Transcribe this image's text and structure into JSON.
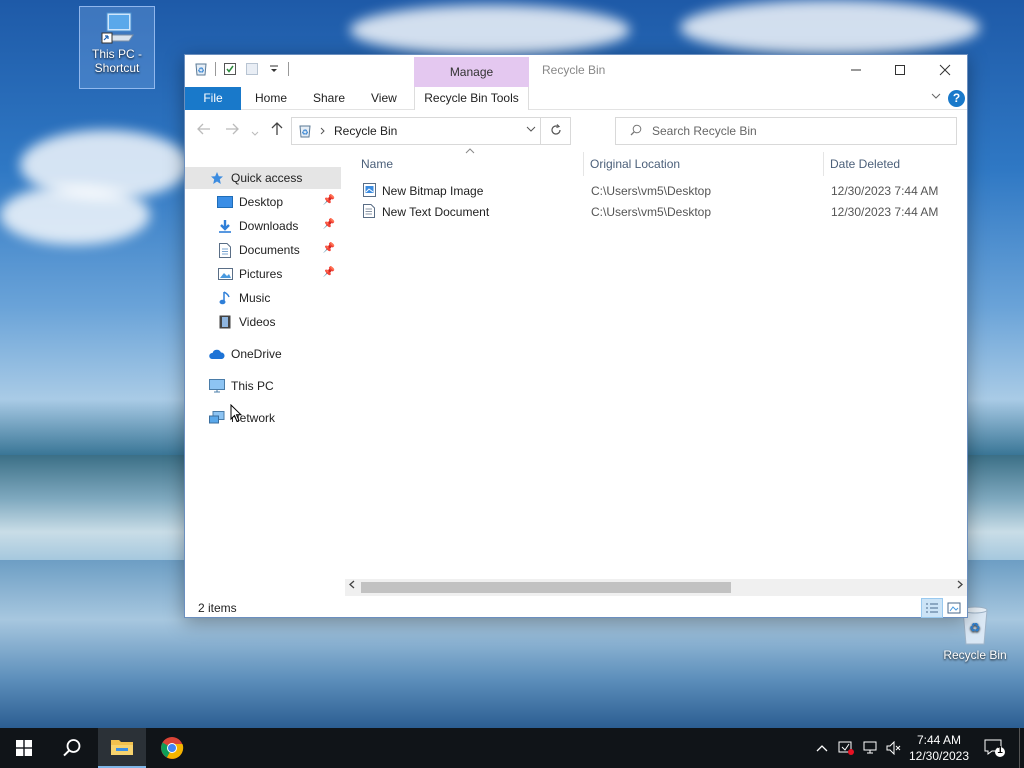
{
  "desktop": {
    "icons": [
      {
        "label": "This PC - Shortcut"
      },
      {
        "label": "Recycle Bin"
      }
    ]
  },
  "window": {
    "title": "Recycle Bin",
    "context_tab": "Manage",
    "ribbon_tabs": [
      "File",
      "Home",
      "Share",
      "View",
      "Recycle Bin Tools"
    ],
    "help": "?",
    "address": {
      "current": "Recycle Bin"
    },
    "search": {
      "placeholder": "Search Recycle Bin"
    },
    "nav": {
      "quick_access": "Quick access",
      "items": [
        "Desktop",
        "Downloads",
        "Documents",
        "Pictures",
        "Music",
        "Videos"
      ],
      "onedrive": "OneDrive",
      "this_pc": "This PC",
      "network": "Network"
    },
    "columns": {
      "name": "Name",
      "original_location": "Original Location",
      "date_deleted": "Date Deleted"
    },
    "files": [
      {
        "name": "New Bitmap Image",
        "location": "C:\\Users\\vm5\\Desktop",
        "date": "12/30/2023 7:44 AM"
      },
      {
        "name": "New Text Document",
        "location": "C:\\Users\\vm5\\Desktop",
        "date": "12/30/2023 7:44 AM"
      }
    ],
    "status": {
      "count": "2 items"
    }
  },
  "taskbar": {
    "time": "7:44 AM",
    "date": "12/30/2023",
    "notification_count": "1"
  },
  "colors": {
    "accent": "#1979ca",
    "manage_tab": "#e4c8f0",
    "taskbar": "#101418"
  }
}
